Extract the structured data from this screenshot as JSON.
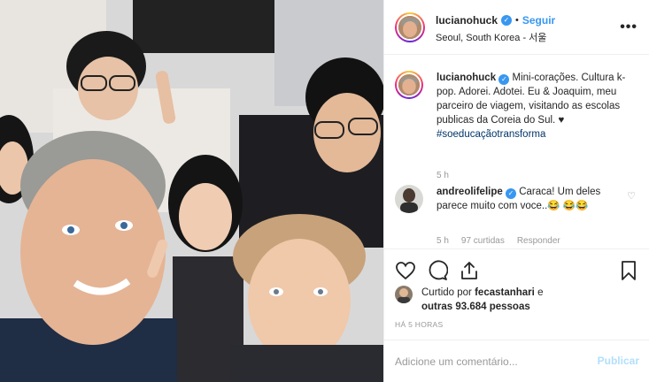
{
  "post": {
    "author": "lucianohuck",
    "follow_label": "Seguir",
    "dot": "•",
    "location": "Seoul, South Korea - 서울",
    "more_label": "•••",
    "verified_mark": "✓",
    "brand_color": "#3897f0"
  },
  "comments": [
    {
      "user": "lucianohuck",
      "text": "Mini-corações. Cultura k-pop. Adorei. Adotei. Eu & Joaquim, meu parceiro de viagem, visitando as escolas publicas da Coreia do Sul. ♥",
      "hashtag": "#soeducaçãotransforma",
      "time": "5 h"
    },
    {
      "user": "andreolifelipe",
      "text": "Caraca! Um deles parece muito com voce..😂 😂😂",
      "time": "5 h",
      "likes": "97 curtidas",
      "reply": "Responder"
    }
  ],
  "actions": {
    "like_icon": "heart-icon",
    "comment_icon": "comment-icon",
    "share_icon": "share-icon",
    "save_icon": "bookmark-icon"
  },
  "likes": {
    "prefix": "Curtido por",
    "user": "fecastanhari",
    "middle": "e",
    "others": "outras 93.684 pessoas"
  },
  "timestamp": "HÁ 5 HORAS",
  "comment_box": {
    "placeholder": "Adicione um comentário...",
    "publish_label": "Publicar"
  }
}
